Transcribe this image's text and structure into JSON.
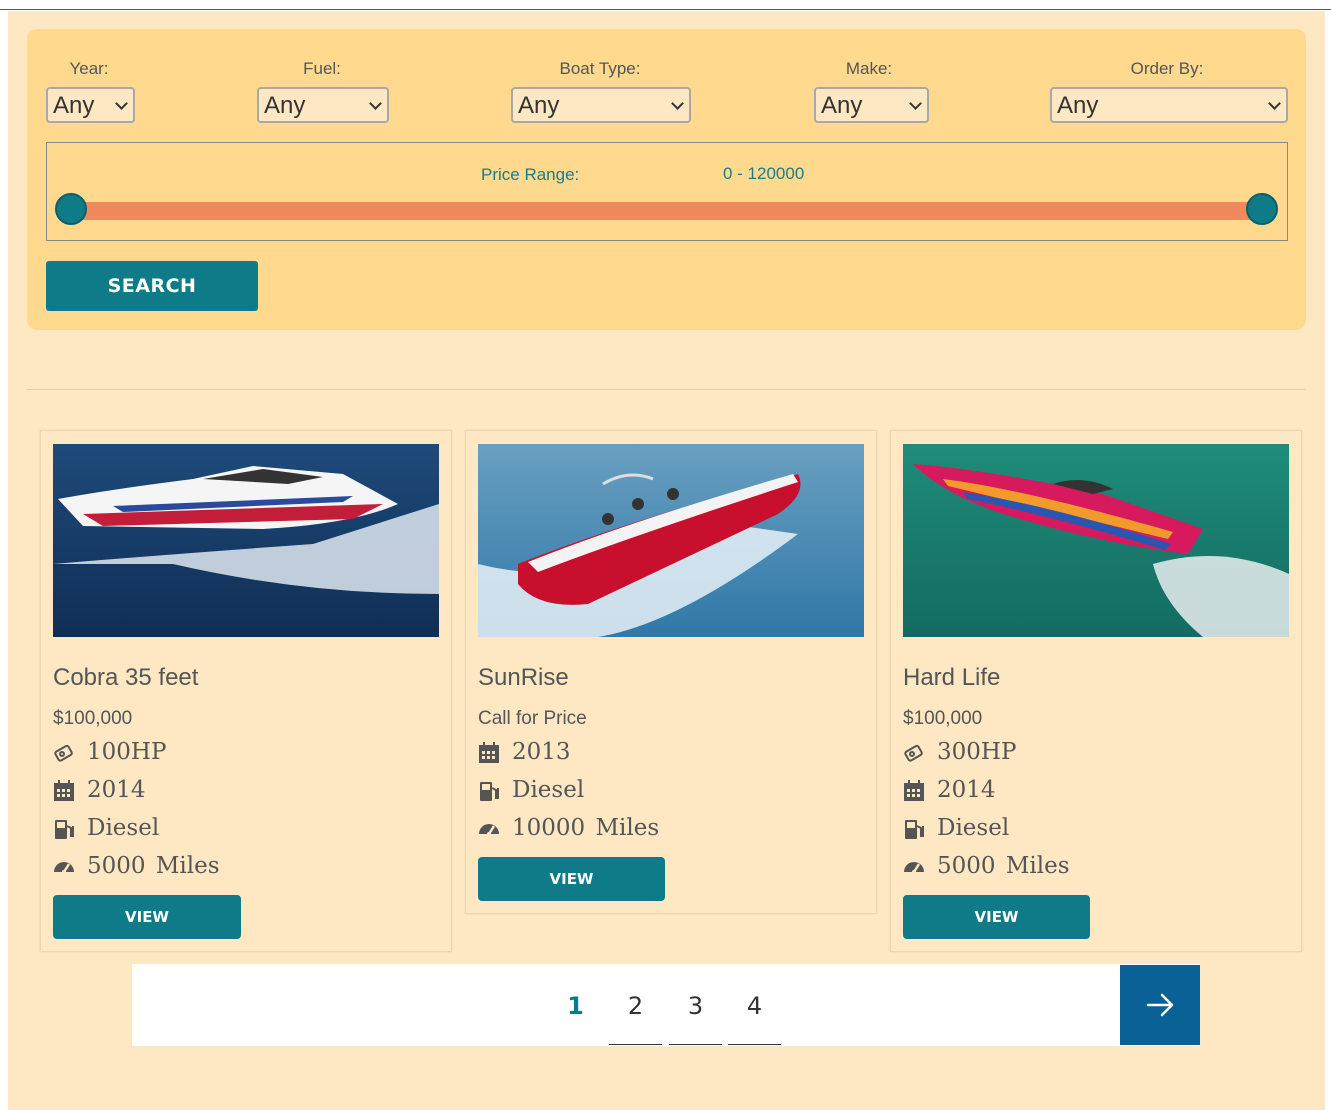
{
  "filters": {
    "year": {
      "label": "Year:",
      "value": "Any"
    },
    "fuel": {
      "label": "Fuel:",
      "value": "Any"
    },
    "boat_type": {
      "label": "Boat Type:",
      "value": "Any"
    },
    "make": {
      "label": "Make:",
      "value": "Any"
    },
    "order_by": {
      "label": "Order By:",
      "value": "Any"
    }
  },
  "price_range": {
    "label": "Price Range:",
    "value": "0 - 120000",
    "min": 0,
    "max": 120000
  },
  "search_label": "SEARCH",
  "listings": [
    {
      "title": "Cobra 35 feet",
      "price": "$100,000",
      "power": "100HP",
      "year": "2014",
      "fuel": "Diesel",
      "mileage": "5000  Miles",
      "view_label": "VIEW"
    },
    {
      "title": "SunRise",
      "price": "Call for Price",
      "year": "2013",
      "fuel": "Diesel",
      "mileage": "10000  Miles",
      "view_label": "VIEW"
    },
    {
      "title": "Hard Life",
      "price": "$100,000",
      "power": "300HP",
      "year": "2014",
      "fuel": "Diesel",
      "mileage": "5000  Miles",
      "view_label": "VIEW"
    }
  ],
  "pagination": {
    "pages": [
      "1",
      "2",
      "3",
      "4"
    ],
    "current": "1",
    "next_icon": "arrow-right-icon"
  },
  "colors": {
    "accent": "#107b88",
    "slider": "#f1895c",
    "panel": "#fed98e",
    "page_bg": "#fee8c3",
    "next": "#0a6196"
  }
}
